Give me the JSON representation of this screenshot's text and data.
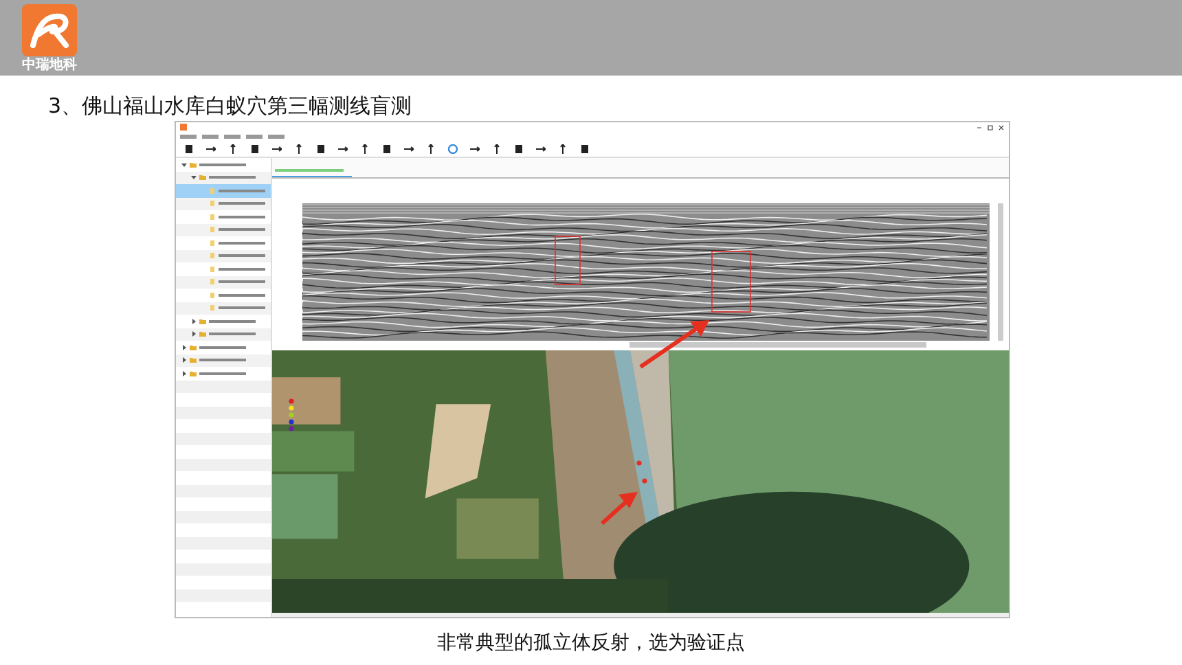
{
  "header": {
    "logo_text": "中瑞地科"
  },
  "slide_title": "3、佛山福山水库白蚁穴第三幅测线盲测",
  "app": {
    "tree": [
      {
        "kind": "folder",
        "expanded": true,
        "selected": false,
        "children": [
          {
            "kind": "folder",
            "expanded": true,
            "selected": false,
            "children": [
              {
                "kind": "file",
                "selected": true
              },
              {
                "kind": "file",
                "selected": false
              },
              {
                "kind": "file",
                "selected": false
              },
              {
                "kind": "file",
                "selected": false
              },
              {
                "kind": "file",
                "selected": false
              },
              {
                "kind": "file",
                "selected": false
              },
              {
                "kind": "file",
                "selected": false
              },
              {
                "kind": "file",
                "selected": false
              },
              {
                "kind": "file",
                "selected": false
              },
              {
                "kind": "file",
                "selected": false
              }
            ]
          },
          {
            "kind": "folder",
            "expanded": false,
            "selected": false
          },
          {
            "kind": "folder",
            "expanded": false,
            "selected": false
          }
        ]
      },
      {
        "kind": "folder",
        "expanded": false,
        "selected": false
      },
      {
        "kind": "folder",
        "expanded": false,
        "selected": false
      },
      {
        "kind": "folder",
        "expanded": false,
        "selected": false
      }
    ],
    "map_legend": [
      {
        "color": "#e02020"
      },
      {
        "color": "#f0e020"
      },
      {
        "color": "#a0d020"
      },
      {
        "color": "#2030d0"
      },
      {
        "color": "#7020a0"
      }
    ]
  },
  "caption": "非常典型的孤立体反射，选为验证点"
}
